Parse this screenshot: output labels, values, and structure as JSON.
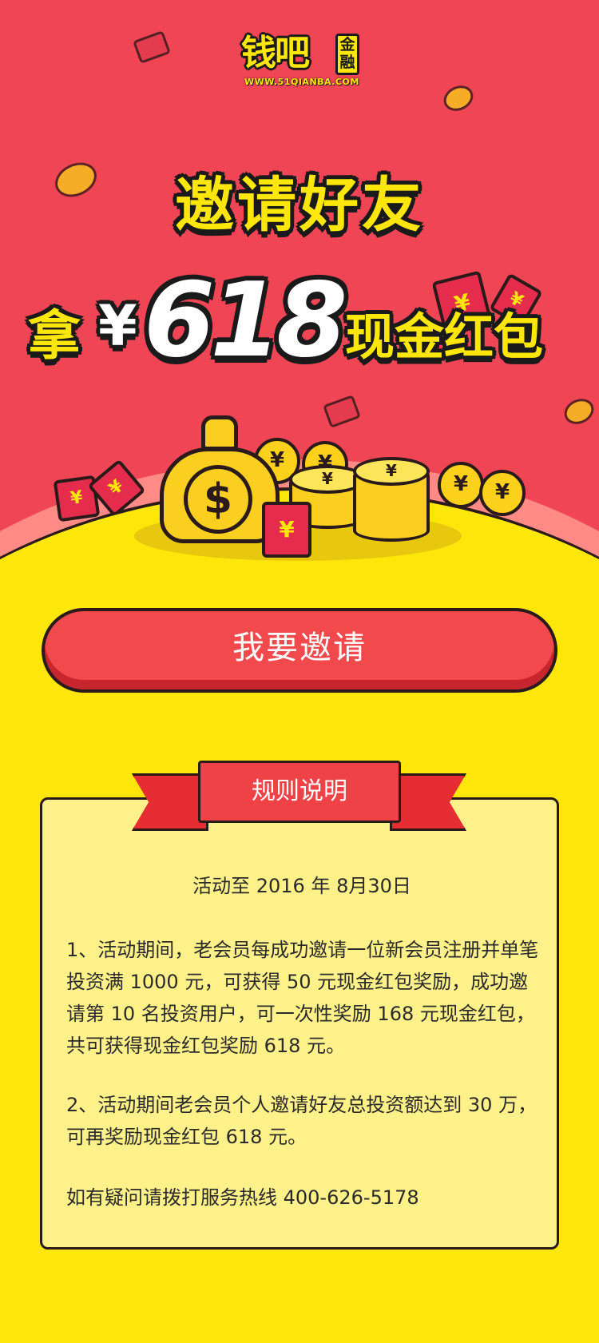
{
  "logo": {
    "main": "钱吧",
    "side": "金融",
    "url": "WWW.51QIANBA.COM"
  },
  "hero": {
    "title": "邀请好友",
    "prefix": "拿",
    "currency": "¥",
    "amount": "618",
    "suffix": "现金红包"
  },
  "icons": {
    "yen": "¥",
    "dollar": "$"
  },
  "invite_button": {
    "label": "我要邀请"
  },
  "rules": {
    "heading": "规则说明",
    "date": "活动至 2016 年 8月30日",
    "item1": "1、活动期间，老会员每成功邀请一位新会员注册并单笔投资满 1000 元，可获得 50 元现金红包奖励，成功邀请第 10 名投资用户，可一次性奖励 168 元现金红包，共可获得现金红包奖励 618 元。",
    "item2": "2、活动期间老会员个人邀请好友总投资额达到 30 万，可再奖励现金红包 618 元。",
    "hotline": "如有疑问请拨打服务热线 400-626-5178"
  },
  "colors": {
    "hero_red": "#f04555",
    "background_yellow": "#fde60a",
    "button_red": "#f24a4c",
    "rules_panel": "#fef18a"
  }
}
